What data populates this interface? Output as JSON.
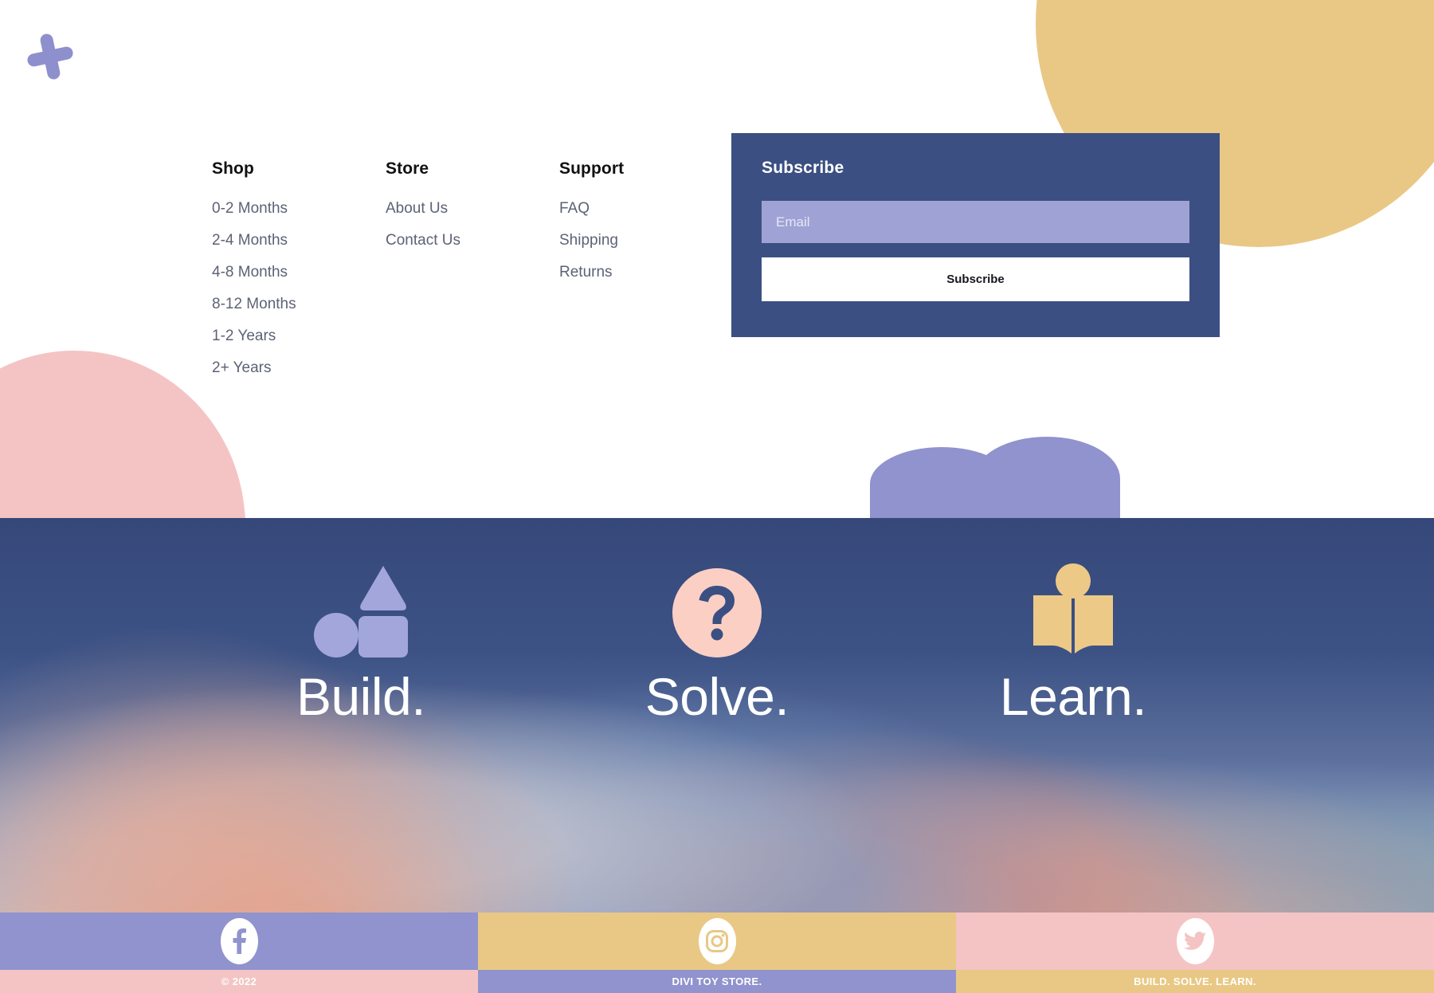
{
  "colors": {
    "navy": "#3b4f82",
    "periwinkle": "#9093cd",
    "periwinkle_light": "#9fa2d4",
    "yellow": "#e9c885",
    "pink": "#f4c4c4",
    "text_muted": "#5d6275",
    "white": "#ffffff"
  },
  "footer": {
    "columns": [
      {
        "title": "Shop",
        "items": [
          "0-2 Months",
          "2-4 Months",
          "4-8 Months",
          "8-12 Months",
          "1-2 Years",
          "2+ Years"
        ]
      },
      {
        "title": "Store",
        "items": [
          "About Us",
          "Contact Us"
        ]
      },
      {
        "title": "Support",
        "items": [
          "FAQ",
          "Shipping",
          "Returns"
        ]
      }
    ]
  },
  "subscribe": {
    "title": "Subscribe",
    "email_placeholder": "Email",
    "email_value": "",
    "button_label": "Subscribe"
  },
  "values": [
    {
      "label": "Build.",
      "icon": "shapes-icon",
      "color": "#a3a6da"
    },
    {
      "label": "Solve.",
      "icon": "question-mark-icon",
      "color": "#fbcfc4"
    },
    {
      "label": "Learn.",
      "icon": "open-book-icon",
      "color": "#ecc987"
    }
  ],
  "social": [
    {
      "network": "Facebook",
      "icon": "facebook-icon",
      "bg": "#9093cd"
    },
    {
      "network": "Instagram",
      "icon": "instagram-icon",
      "bg": "#e9c885"
    },
    {
      "network": "Twitter",
      "icon": "twitter-icon",
      "bg": "#f4c4c4"
    }
  ],
  "bottom_bar": [
    {
      "text": "© 2022",
      "bg": "#f4c4c4"
    },
    {
      "text": "DIVI TOY STORE.",
      "bg": "#9093cd"
    },
    {
      "text": "BUILD. SOLVE. LEARN.",
      "bg": "#e9c885"
    }
  ],
  "decorations": {
    "plus": "plus-shape",
    "yellow_circle": "circle-shape",
    "pink_hill": "hill-shape",
    "cloud": "cloud-shape"
  }
}
